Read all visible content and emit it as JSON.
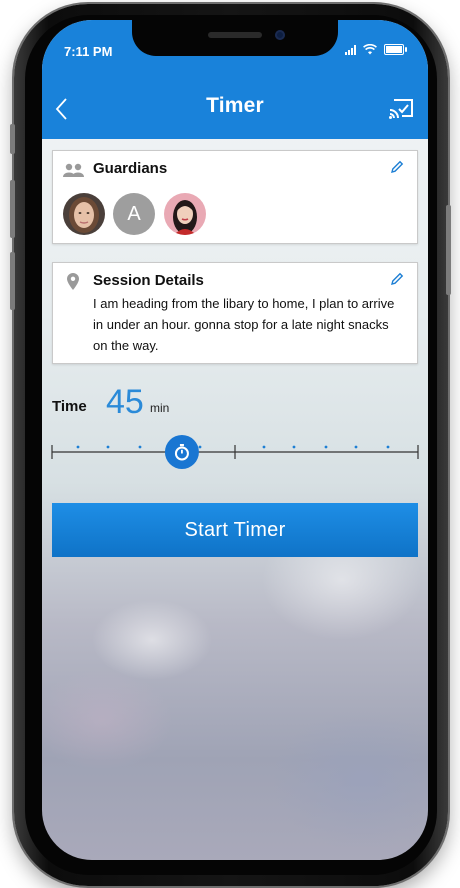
{
  "status_bar": {
    "time": "7:11 PM"
  },
  "nav": {
    "title": "Timer",
    "back_icon": "chevron-left-icon",
    "action_icon": "cast-check-icon"
  },
  "guardians": {
    "title": "Guardians",
    "icon": "group-icon",
    "edit_icon": "pencil-icon",
    "avatars": [
      {
        "type": "photo"
      },
      {
        "type": "initial",
        "initial": "A"
      },
      {
        "type": "photo"
      }
    ]
  },
  "session": {
    "title": "Session Details",
    "icon": "location-pin-icon",
    "edit_icon": "pencil-icon",
    "text": "I am heading from the libary to home, I plan to arrive in under an hour. gonna stop for a late night snacks on the way."
  },
  "time": {
    "label": "Time",
    "value": "45",
    "unit": "min",
    "slider_fraction": 0.355,
    "slider_icon": "stopwatch-icon"
  },
  "start_button": {
    "label": "Start Timer"
  },
  "colors": {
    "accent": "#1982da",
    "button": "#1579d0",
    "value_text": "#2a8ad8"
  }
}
